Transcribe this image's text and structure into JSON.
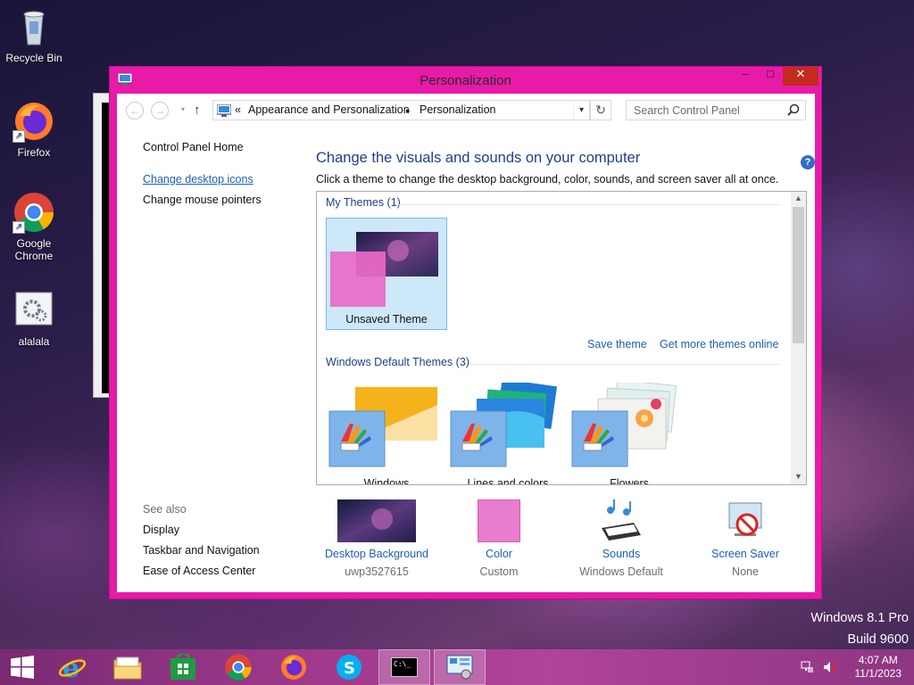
{
  "desktop": {
    "icons": [
      {
        "label": "Recycle Bin"
      },
      {
        "label": "Firefox"
      },
      {
        "label": "Google Chrome"
      },
      {
        "label": "alalala"
      }
    ],
    "watermark": {
      "line1": "Windows 8.1 Pro",
      "line2": "Build 9600"
    }
  },
  "window": {
    "title": "Personalization",
    "min_glyph": "–",
    "max_glyph": "□",
    "close_glyph": "✕"
  },
  "addressbar": {
    "back": "←",
    "forward": "→",
    "up": "↑",
    "chevron": "«",
    "crumbs": [
      "Appearance and Personalization",
      "Personalization"
    ],
    "separator": "▸",
    "refresh": "↻",
    "search_placeholder": "Search Control Panel"
  },
  "left_pane": {
    "home": "Control Panel Home",
    "links": [
      "Change desktop icons",
      "Change mouse pointers"
    ],
    "see_also_heading": "See also",
    "see_also": [
      "Display",
      "Taskbar and Navigation",
      "Ease of Access Center"
    ]
  },
  "main": {
    "title": "Change the visuals and sounds on your computer",
    "subtitle": "Click a theme to change the desktop background, color, sounds, and screen saver all at once.",
    "help": "?",
    "my_themes": {
      "heading": "My Themes (1)",
      "items": [
        {
          "label": "Unsaved Theme",
          "selected": true,
          "color": "#e86ac8"
        }
      ],
      "save_theme": "Save theme",
      "get_more": "Get more themes online"
    },
    "default_themes": {
      "heading": "Windows Default Themes (3)",
      "items": [
        {
          "label": "Windows",
          "color": "#7fb4ea"
        },
        {
          "label": "Lines and colors",
          "color": "#7fb4ea"
        },
        {
          "label": "Flowers",
          "color": "#7fb4ea"
        }
      ]
    },
    "bottom": [
      {
        "label": "Desktop Background",
        "sub": "uwp3527615"
      },
      {
        "label": "Color",
        "sub": "Custom",
        "color": "#e87cce"
      },
      {
        "label": "Sounds",
        "sub": "Windows Default"
      },
      {
        "label": "Screen Saver",
        "sub": "None"
      }
    ]
  },
  "taskbar": {
    "clock": {
      "time": "4:07 AM",
      "date": "11/1/2023"
    },
    "cmd_prompt": "C:\\_"
  },
  "colors": {
    "accent": "#e81aa8",
    "link": "#1c5fb8",
    "heading": "#1e3f8a"
  }
}
